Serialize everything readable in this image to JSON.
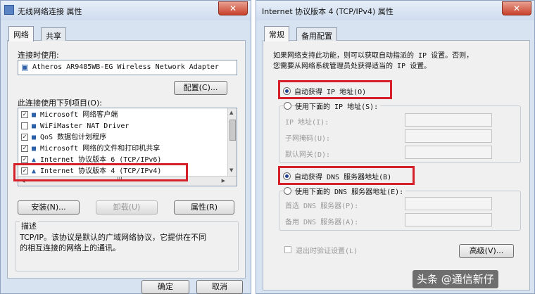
{
  "left_window": {
    "title": "无线网络连接 属性",
    "close_symbol": "✕",
    "tabs": [
      "网络",
      "共享"
    ],
    "connect_using_label": "连接时使用:",
    "adapter_name": "Atheros AR9485WB-EG Wireless Network Adapter",
    "configure_button": "配置(C)...",
    "items_label": "此连接使用下列项目(O):",
    "items": [
      {
        "checked": true,
        "label": "Microsoft 网络客户端"
      },
      {
        "checked": false,
        "label": "WiFiMaster NAT Driver"
      },
      {
        "checked": true,
        "label": "QoS 数据包计划程序"
      },
      {
        "checked": true,
        "label": "Microsoft 网络的文件和打印机共享"
      },
      {
        "checked": true,
        "label": "Internet 协议版本 6 (TCP/IPv6)"
      },
      {
        "checked": true,
        "label": "Internet 协议版本 4 (TCP/IPv4)"
      }
    ],
    "scroll_marker": "III",
    "install_button": "安装(N)...",
    "uninstall_button": "卸载(U)",
    "properties_button": "属性(R)",
    "description_label": "描述",
    "description_text_1": "TCP/IP。该协议是默认的广域网络协议，它提供在不同",
    "description_text_2": "的相互连接的网络上的通讯。",
    "ok_button": "确定",
    "cancel_button": "取消"
  },
  "right_window": {
    "title": "Internet 协议版本 4 (TCP/IPv4) 属性",
    "close_symbol": "✕",
    "tabs": [
      "常规",
      "备用配置"
    ],
    "intro_line_1": "如果网络支持此功能，则可以获取自动指派的 IP 设置。否则，",
    "intro_line_2": "您需要从网络系统管理员处获得适当的 IP 设置。",
    "auto_ip_label": "自动获得 IP 地址(O)",
    "manual_ip_label": "使用下面的 IP 地址(S):",
    "ip_address_label": "IP 地址(I):",
    "subnet_label": "子网掩码(U):",
    "gateway_label": "默认网关(D):",
    "auto_dns_label": "自动获得 DNS 服务器地址(B)",
    "manual_dns_label": "使用下面的 DNS 服务器地址(E):",
    "preferred_dns_label": "首选 DNS 服务器(P):",
    "alternate_dns_label": "备用 DNS 服务器(A):",
    "validate_label": "退出时验证设置(L)",
    "advanced_button": "高级(V)...",
    "auto_ip_selected": true,
    "auto_dns_selected": true
  },
  "watermark": "头条 @通信新仔",
  "colors": {
    "highlight": "#d5202a",
    "window_frame": "#d7e3f1"
  }
}
